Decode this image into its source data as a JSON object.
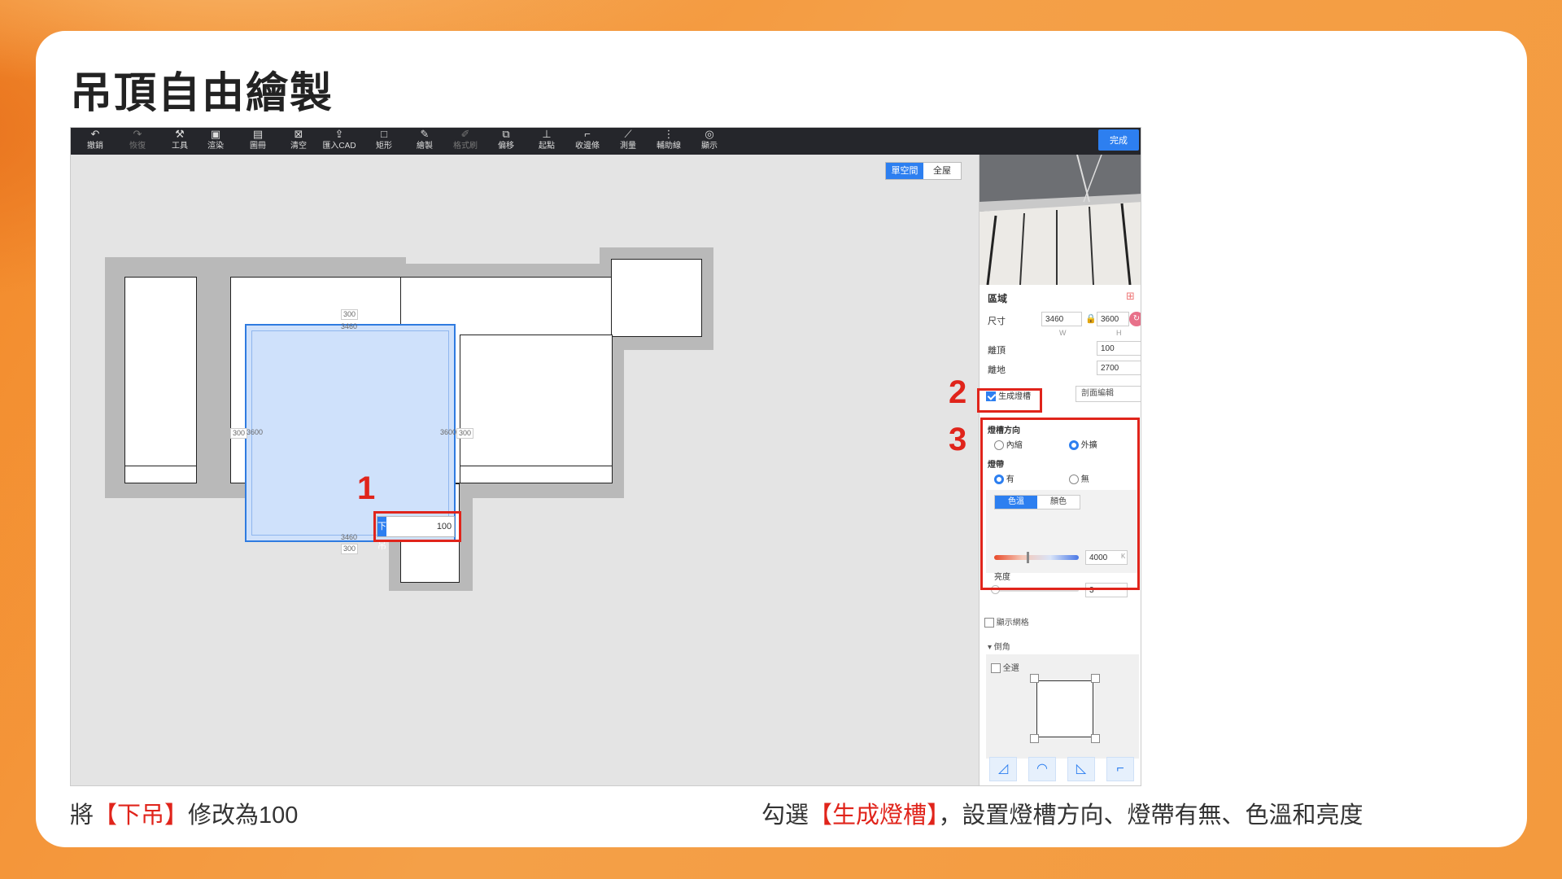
{
  "page": {
    "title": "吊頂自由繪製",
    "caption_left": {
      "pre": "將",
      "hl": "【下吊】",
      "post": "修改為100"
    },
    "caption_right": {
      "pre": "勾選",
      "hl": "【生成燈槽】",
      "post": "，設置燈槽方向、燈帶有無、色溫和亮度"
    }
  },
  "toolbar": {
    "items": [
      {
        "label": "撤銷",
        "icon": "undo-icon",
        "glyph": "↶"
      },
      {
        "label": "恢復",
        "icon": "redo-icon",
        "glyph": "↷"
      },
      {
        "label": "工具",
        "icon": "tool-icon",
        "glyph": "⚒"
      },
      {
        "label": "渲染",
        "icon": "render-icon",
        "glyph": "▣"
      },
      {
        "label": "圖冊",
        "icon": "album-icon",
        "glyph": "▤"
      },
      {
        "label": "清空",
        "icon": "clear-icon",
        "glyph": "⊠"
      },
      {
        "label": "匯入CAD",
        "icon": "import-cad-icon",
        "glyph": "⇪"
      },
      {
        "label": "矩形",
        "icon": "rectangle-icon",
        "glyph": "□"
      },
      {
        "label": "繪製",
        "icon": "draw-icon",
        "glyph": "✎"
      },
      {
        "label": "格式刷",
        "icon": "format-brush-icon",
        "glyph": "✐"
      },
      {
        "label": "偏移",
        "icon": "offset-icon",
        "glyph": "⧉"
      },
      {
        "label": "起點",
        "icon": "start-point-icon",
        "glyph": "⊥"
      },
      {
        "label": "收邊條",
        "icon": "edge-strip-icon",
        "glyph": "⌐"
      },
      {
        "label": "測量",
        "icon": "measure-icon",
        "glyph": "⟋"
      },
      {
        "label": "輔助線",
        "icon": "guide-line-icon",
        "glyph": "⋮"
      },
      {
        "label": "顯示",
        "icon": "display-icon",
        "glyph": "◎"
      }
    ],
    "done_label": "完成"
  },
  "canvas": {
    "view_single": "單空間",
    "view_all": "全屋",
    "dims": {
      "top": "300",
      "top_inner": "3460",
      "left": "300",
      "left_inner": "3600",
      "right_inner": "3600",
      "right": "300",
      "bottom_inner": "3460",
      "bottom": "300"
    },
    "drop": {
      "label": "下吊",
      "value": "100"
    },
    "markers": {
      "one": "1",
      "two": "2",
      "three": "3"
    }
  },
  "panel": {
    "section_title": "區域",
    "size_label": "尺寸",
    "width_value": "3460",
    "height_value": "3600",
    "w_sub": "W",
    "h_sub": "H",
    "from_top_label": "離頂",
    "from_top_value": "100",
    "from_floor_label": "離地",
    "from_floor_value": "2700",
    "generate_slot_label": "生成燈槽",
    "section_edit_label": "剖面編輯",
    "slot_direction_label": "燈槽方向",
    "dir_inner": "內縮",
    "dir_outer": "外擴",
    "strip_label": "燈帶",
    "strip_yes": "有",
    "strip_no": "無",
    "tab_color_temp": "色溫",
    "tab_color": "顏色",
    "color_temp_value": "4000",
    "color_temp_unit": "K",
    "brightness_label": "亮度",
    "brightness_value": "3",
    "show_grid_label": "顯示網格",
    "chamfer_label": "▾ 倒角",
    "select_all_label": "全選",
    "accent": "#2d7ff0",
    "highlight": "#e0241b"
  }
}
